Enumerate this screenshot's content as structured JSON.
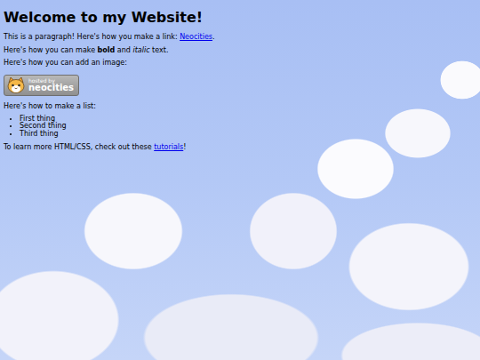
{
  "heading": "Welcome to my Website!",
  "intro": {
    "before": "This is a paragraph! Here's how you make a link: ",
    "link": "Neocities",
    "after": "."
  },
  "formatting": {
    "before": "Here's how you can make ",
    "bold": "bold",
    "middle": " and ",
    "italic": "italic",
    "after": " text."
  },
  "image_caption": "Here's how you can add an image:",
  "badge": {
    "line1": "hosted by",
    "line2": "neocities"
  },
  "list_caption": "Here's how to make a list:",
  "list": [
    "First thing",
    "Second thing",
    "Third thing"
  ],
  "outro": {
    "before": "To learn more HTML/CSS, check out these ",
    "link": "tutorials",
    "after": "!"
  }
}
